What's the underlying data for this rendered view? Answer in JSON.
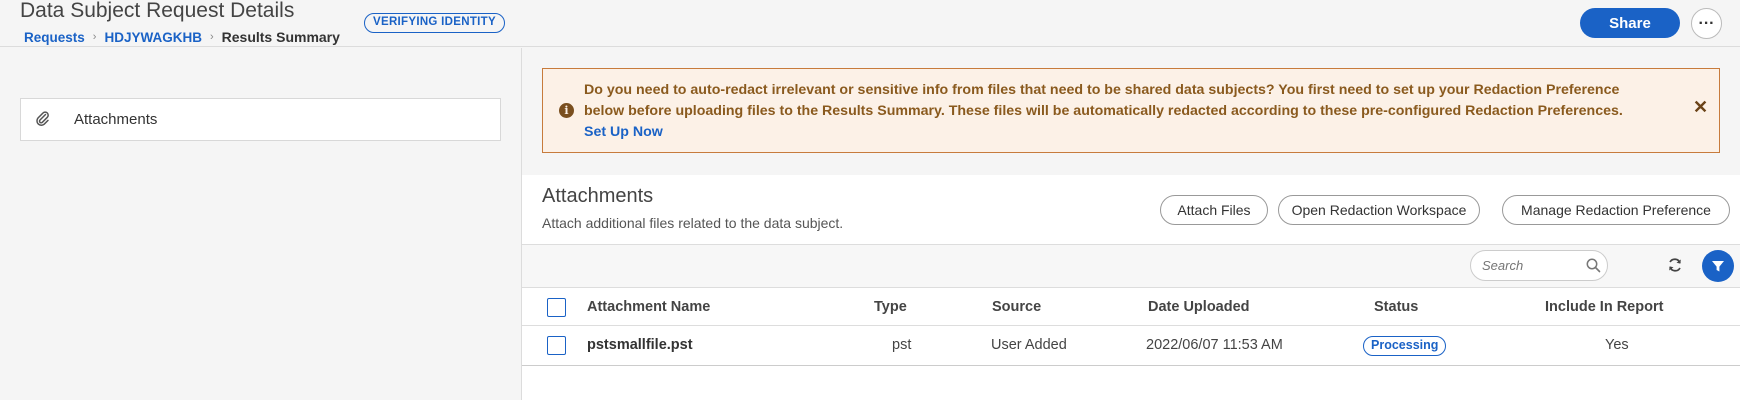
{
  "header": {
    "title": "Data Subject Request Details",
    "status_badge": "VERIFYING IDENTITY",
    "breadcrumb": {
      "requests": "Requests",
      "request_id": "HDJYWAGKHB",
      "current": "Results Summary"
    },
    "share_label": "Share",
    "more_label": "···"
  },
  "sidebar": {
    "items": [
      {
        "label": "Attachments",
        "icon": "paperclip-icon"
      }
    ]
  },
  "alert": {
    "message": "Do you need to auto-redact irrelevant or sensitive info from files that need to be shared data subjects? You first need to set up your Redaction Preference below before uploading files to the Results Summary. These files will be automatically redacted according to these pre-configured Redaction Preferences.",
    "link": "Set Up Now",
    "close": "✕"
  },
  "attachments": {
    "title": "Attachments",
    "subtitle": "Attach additional files related to the data subject.",
    "buttons": {
      "attach": "Attach Files",
      "open_workspace": "Open Redaction Workspace",
      "manage": "Manage Redaction Preference"
    },
    "search_placeholder": "Search",
    "columns": [
      "Attachment Name",
      "Type",
      "Source",
      "Date Uploaded",
      "Status",
      "Include In Report"
    ],
    "rows": [
      {
        "name": "pstsmallfile.pst",
        "type": "pst",
        "source": "User Added",
        "date_uploaded": "2022/06/07 11:53 AM",
        "status": "Processing",
        "include_in_report": "Yes"
      }
    ]
  },
  "colors": {
    "primary": "#1a62c6",
    "alert_bg": "#fcf1e7",
    "alert_border": "#c77b3c",
    "alert_text": "#8a5a1e"
  }
}
